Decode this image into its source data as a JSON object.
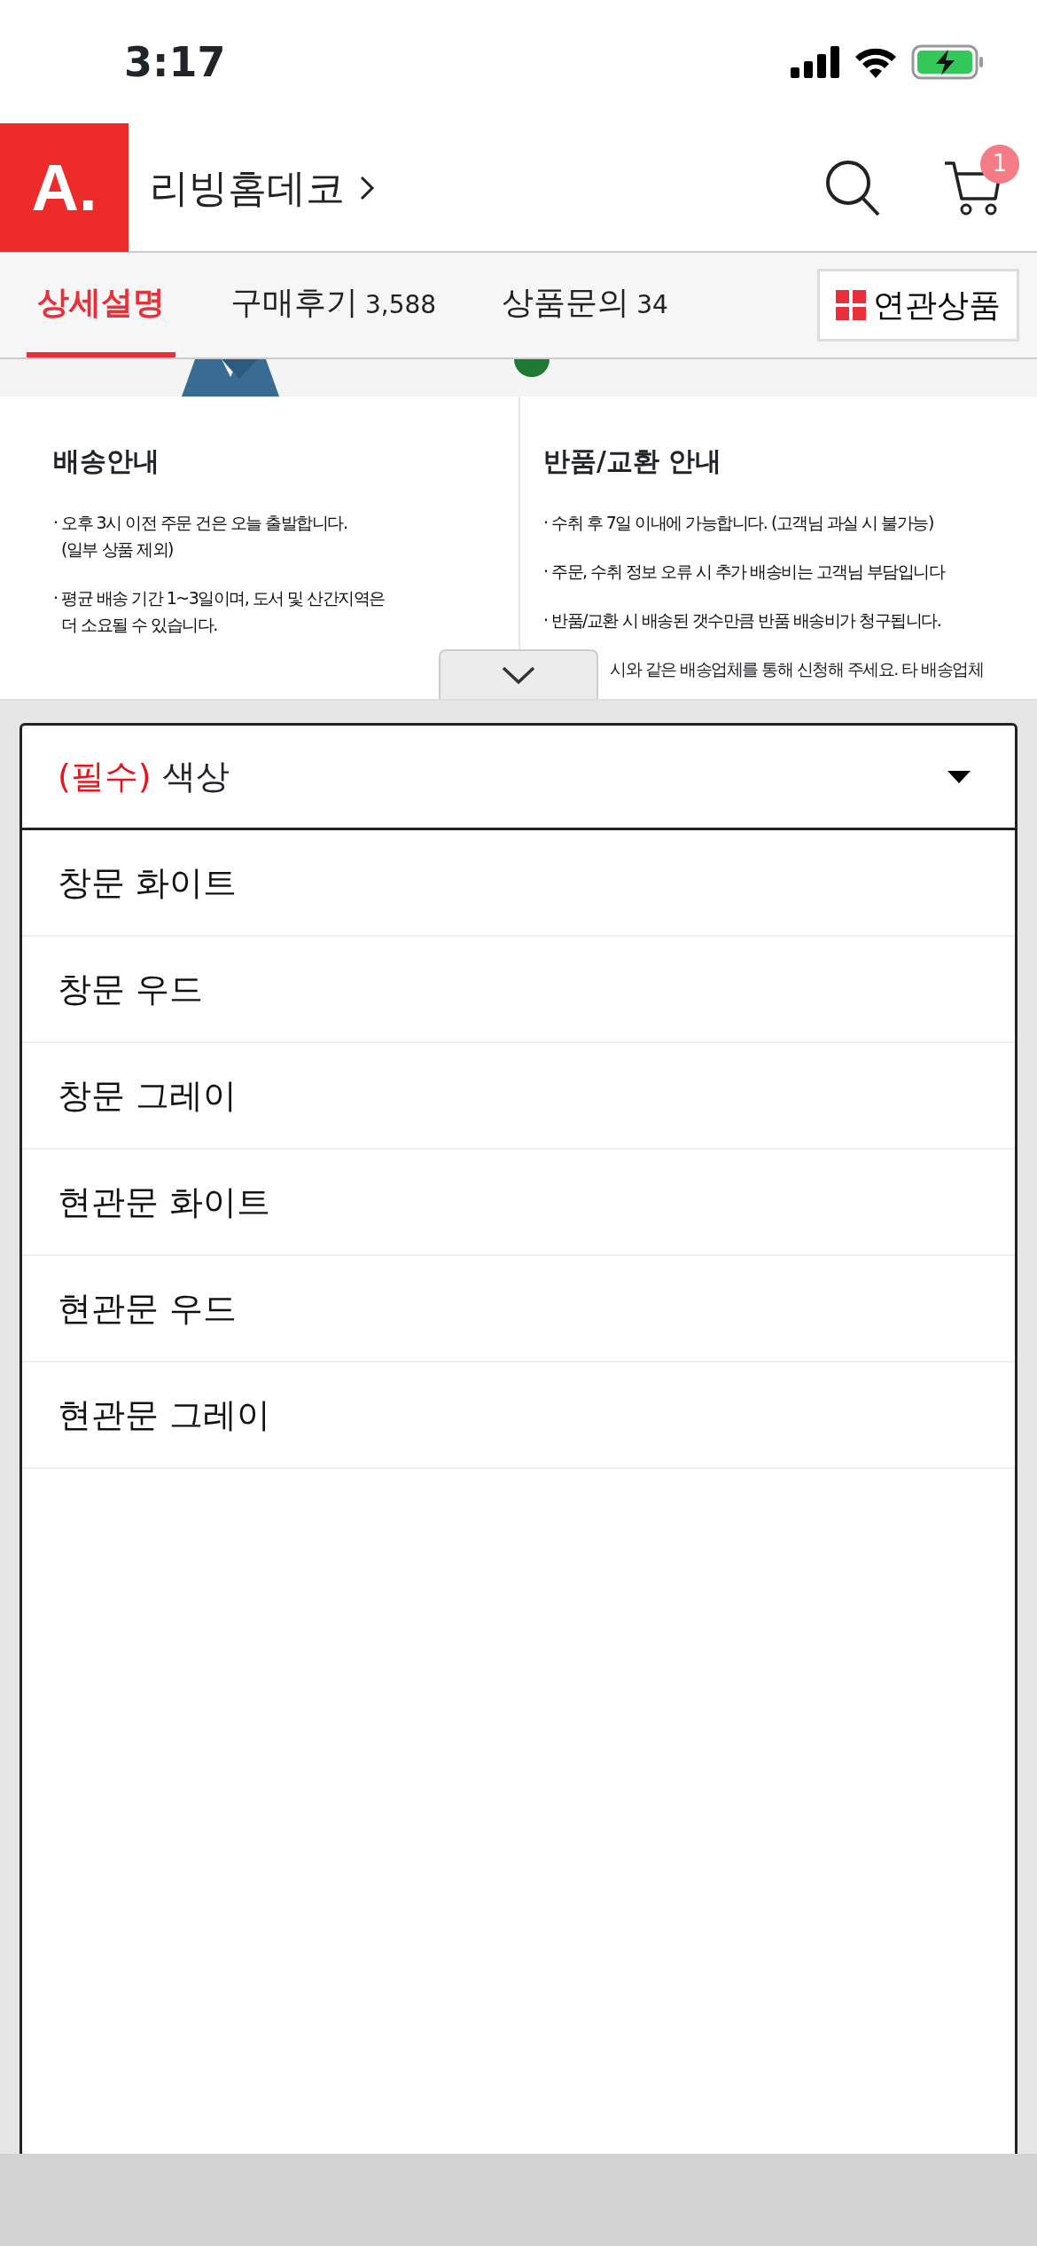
{
  "status_bar": {
    "time": "3:17"
  },
  "header": {
    "logo": "A.",
    "store": "리빙홈데코",
    "cart_count": "1"
  },
  "tabs": [
    {
      "label": "상세설명",
      "selected": true
    },
    {
      "label": "구매후기",
      "count": "3,588",
      "selected": false
    },
    {
      "label": "상품문의",
      "count": "34",
      "selected": false
    }
  ],
  "related_button": {
    "label": "연관상품"
  },
  "info_bullet": "·",
  "info_panels": [
    {
      "title": "배송안내",
      "items": [
        {
          "lines": [
            "오후 3시 이전 주문 건은 오늘 출발합니다.",
            "(일부 상품 제외)"
          ]
        },
        {
          "lines": [
            "평균 배송 기간 1~3일이며, 도서 및 산간지역은",
            "더 소요될 수 있습니다."
          ]
        }
      ]
    },
    {
      "title": "반품/교환 안내",
      "items": [
        {
          "lines": [
            "수취 후 7일 이내에 가능합니다. (고객님 과실 시 불가능)"
          ]
        },
        {
          "lines": [
            "주문, 수취 정보 오류 시 추가 배송비는 고객님 부담입니다"
          ]
        },
        {
          "lines": [
            "반품/교환 시 배송된 갯수만큼 반품 배송비가 청구됩니다."
          ]
        }
      ],
      "cut_line": "시와 같은 배송업체를 통해 신청해 주세요. 타 배송업체"
    }
  ],
  "option_select": {
    "required_mark": "(필수)",
    "label": "색상",
    "expanded": true,
    "options": [
      "창문 화이트",
      "창문 우드",
      "창문 그레이",
      "현관문 화이트",
      "현관문 우드",
      "현관문 그레이"
    ]
  }
}
